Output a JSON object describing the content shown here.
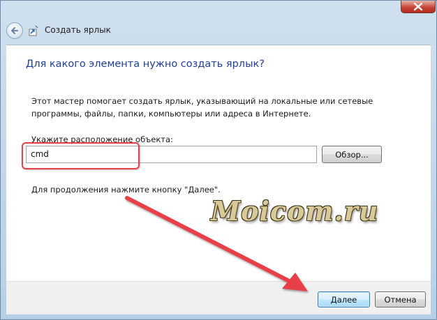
{
  "window": {
    "title": "Создать ярлык"
  },
  "wizard": {
    "heading": "Для какого элемента нужно создать ярлык?",
    "description": "Этот мастер помогает создать ярлык, указывающий на локальные или сетевые программы, файлы, папки, компьютеры или адреса в Интернете.",
    "location_label": "Укажите расположение объекта:",
    "location_value": "cmd",
    "browse_label": "Обзор...",
    "hint": "Для продолжения нажмите кнопку \"Далее\"."
  },
  "footer": {
    "next_label": "Далее",
    "cancel_label": "Отмена"
  },
  "watermark": {
    "text": "Moicom.ru"
  },
  "annotations": {
    "color": "#e8404a"
  },
  "icons": {
    "back": "back-arrow-icon",
    "wizard": "shortcut-wizard-icon",
    "close": "close-icon"
  }
}
